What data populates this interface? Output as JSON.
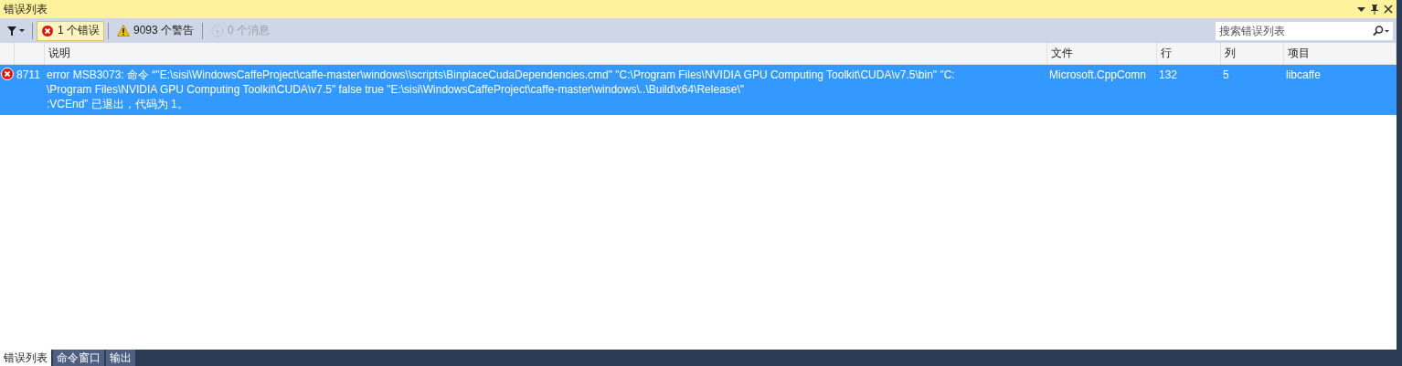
{
  "window": {
    "title": "错误列表"
  },
  "toolbar": {
    "filters": [
      {
        "kind": "error",
        "label": "1 个错误",
        "selected": true,
        "disabled": false
      },
      {
        "kind": "warning",
        "label": "9093 个警告",
        "selected": false,
        "disabled": false
      },
      {
        "kind": "message",
        "label": "0 个消息",
        "selected": false,
        "disabled": true
      }
    ],
    "search": {
      "placeholder": "搜索错误列表"
    }
  },
  "table": {
    "columns": [
      "",
      "",
      "说明",
      "文件",
      "行",
      "列",
      "项目"
    ],
    "rows": [
      {
        "kind": "error",
        "selected": true,
        "code": "8711",
        "description_lines": [
          "error MSB3073: 命令 “\"E:\\sisi\\WindowsCaffeProject\\caffe-master\\windows\\\\scripts\\BinplaceCudaDependencies.cmd\" \"C:\\Program Files\\NVIDIA GPU Computing Toolkit\\CUDA\\v7.5\\bin\" \"C:",
          "\\Program Files\\NVIDIA GPU Computing Toolkit\\CUDA\\v7.5\" false true \"E:\\sisi\\WindowsCaffeProject\\caffe-master\\windows\\..\\Build\\x64\\Release\\\"",
          ":VCEnd” 已退出，代码为 1。"
        ],
        "file": "Microsoft.CppComn",
        "line": "132",
        "column": "5",
        "project": "libcaffe"
      }
    ]
  },
  "bottom_tabs": [
    {
      "label": "错误列表",
      "selected": true
    },
    {
      "label": "命令窗口",
      "selected": false
    },
    {
      "label": "输出",
      "selected": false
    }
  ]
}
